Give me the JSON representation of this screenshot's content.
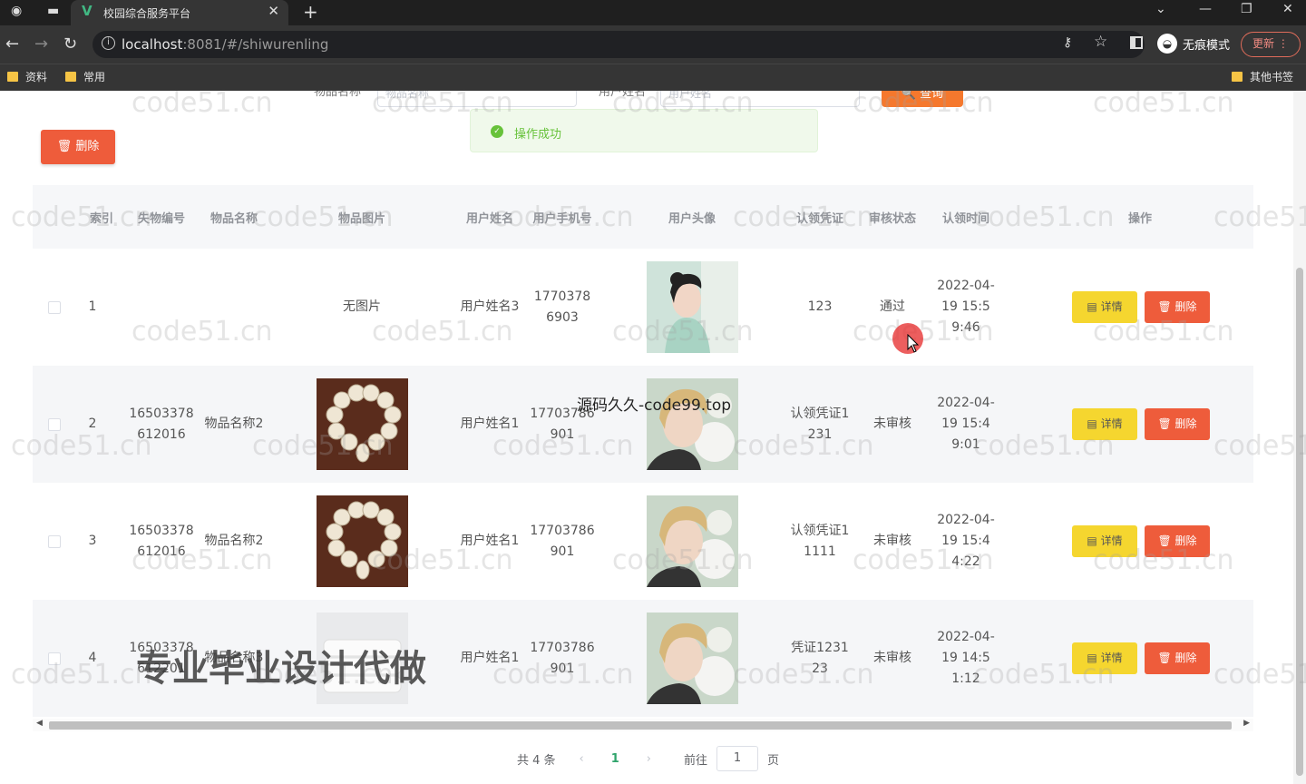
{
  "browser": {
    "tab_title": "校园综合服务平台",
    "url_host": "localhost",
    "url_rest": ":8081/#/shiwurenling",
    "incognito_label": "无痕模式",
    "update_label": "更新",
    "bookmarks": [
      "资料",
      "常用"
    ],
    "other_bookmarks": "其他书签"
  },
  "search": {
    "field1_label": "物品名称",
    "field1_placeholder": "物品名称",
    "field2_label": "用户姓名",
    "field2_placeholder": "用户姓名",
    "query_label": "查询"
  },
  "toast": {
    "message": "操作成功",
    "color": "#67c23a"
  },
  "toolbar": {
    "delete_label": "删除"
  },
  "table": {
    "headers": [
      "索引",
      "失物编号",
      "物品名称",
      "物品图片",
      "用户姓名",
      "用户手机号",
      "用户头像",
      "认领凭证",
      "审核状态",
      "认领时间",
      "操作"
    ],
    "rows": [
      {
        "index": "1",
        "lost_id": "",
        "item_name": "",
        "item_image": "无图片",
        "user_name": "用户姓名3",
        "phone": "17703786903",
        "voucher": "123",
        "status": "通过",
        "time": "2022-04-19 15:59:46"
      },
      {
        "index": "2",
        "lost_id": "16503378612016",
        "item_name": "物品名称2",
        "item_image": "beads",
        "user_name": "用户姓名1",
        "phone": "17703786901",
        "voucher": "认领凭证1231",
        "status": "未审核",
        "time": "2022-04-19 15:49:01"
      },
      {
        "index": "3",
        "lost_id": "16503378612016",
        "item_name": "物品名称2",
        "item_image": "beads",
        "user_name": "用户姓名1",
        "phone": "17703786901",
        "voucher": "认领凭证11111",
        "status": "未审核",
        "time": "2022-04-19 15:44:22"
      },
      {
        "index": "4",
        "lost_id": "16503378612201",
        "item_name": "物品名称3",
        "item_image": "towel",
        "user_name": "用户姓名1",
        "phone": "17703786901",
        "voucher": "凭证123123",
        "status": "未审核",
        "time": "2022-04-19 14:51:12"
      }
    ],
    "detail_label": "详情",
    "delete_label": "删除"
  },
  "pagination": {
    "total_text": "共 4 条",
    "current_page": "1",
    "goto_label": "前往",
    "goto_value": "1",
    "page_suffix": "页"
  },
  "overlays": {
    "watermark": "code51.cn",
    "site_mark": "源码久久-code99.top",
    "ad_text": "专业毕业设计代做"
  },
  "colors": {
    "danger": "#ee5c3b",
    "warning": "#f5d62f",
    "primary": "#f5782d",
    "success": "#67c23a"
  }
}
